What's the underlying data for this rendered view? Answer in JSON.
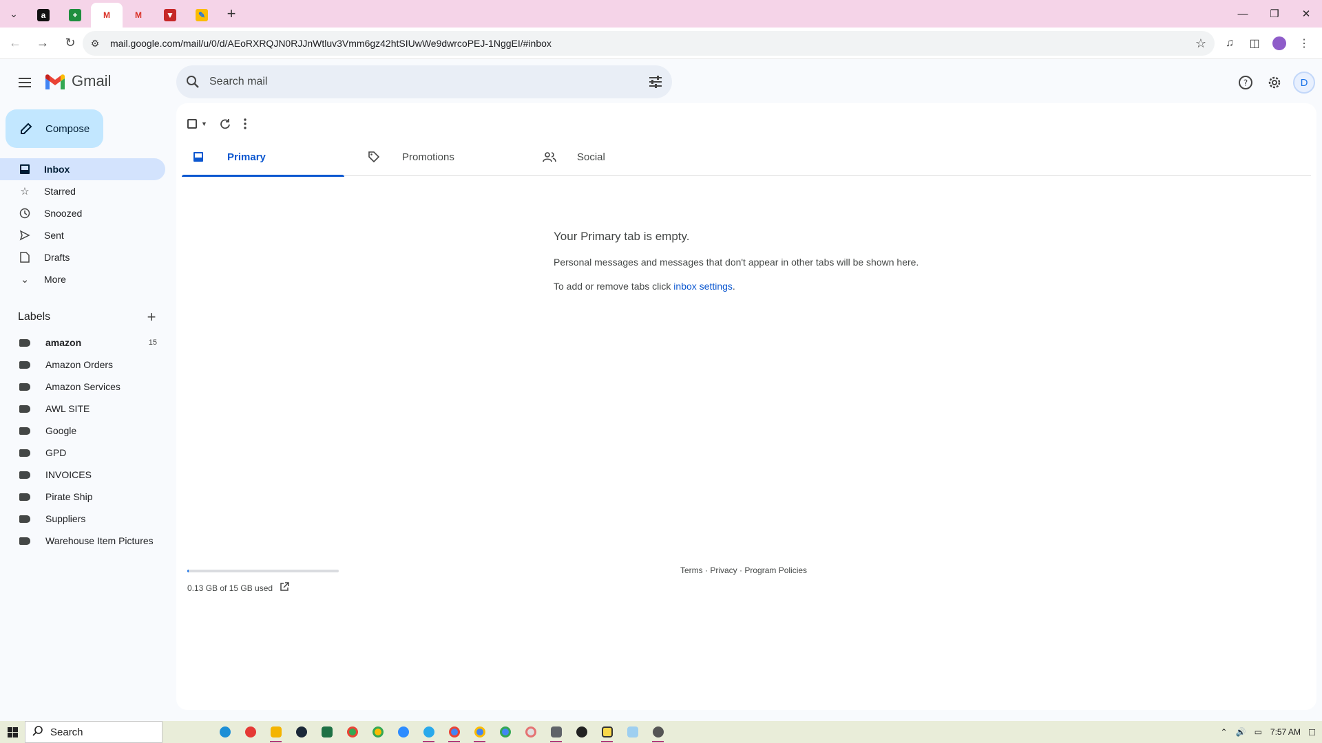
{
  "browser": {
    "url": "mail.google.com/mail/u/0/d/AEoRXRQJN0RJJnWtluv3Vmm6gz42htSIUwWe9dwrcoPEJ-1NggEI/#inbox",
    "tabs": [
      {
        "icon": "amazon-icon",
        "active": false
      },
      {
        "icon": "sheets-icon",
        "active": false
      },
      {
        "icon": "gmail-icon",
        "active": true
      },
      {
        "icon": "gmail-icon",
        "active": false
      },
      {
        "icon": "vivaldi-icon",
        "active": false
      },
      {
        "icon": "pencil-app-icon",
        "active": false
      }
    ]
  },
  "gmail": {
    "brand": "Gmail",
    "search_placeholder": "Search mail",
    "avatar_initial": "D",
    "compose_label": "Compose"
  },
  "nav": {
    "inbox": "Inbox",
    "starred": "Starred",
    "snoozed": "Snoozed",
    "sent": "Sent",
    "drafts": "Drafts",
    "more": "More"
  },
  "labels": {
    "title": "Labels",
    "items": [
      {
        "name": "amazon",
        "count": "15"
      },
      {
        "name": "Amazon Orders"
      },
      {
        "name": "Amazon Services"
      },
      {
        "name": "AWL SITE"
      },
      {
        "name": "Google"
      },
      {
        "name": "GPD"
      },
      {
        "name": "INVOICES"
      },
      {
        "name": "Pirate Ship"
      },
      {
        "name": "Suppliers"
      },
      {
        "name": "Warehouse Item Pictures"
      }
    ]
  },
  "inbox_tabs": {
    "primary": "Primary",
    "promotions": "Promotions",
    "social": "Social"
  },
  "empty_state": {
    "title": "Your Primary tab is empty.",
    "line1": "Personal messages and messages that don't appear in other tabs will be shown here.",
    "line2_prefix": "To add or remove tabs click ",
    "line2_link": "inbox settings",
    "line2_suffix": "."
  },
  "storage": {
    "text": "0.13 GB of 15 GB used",
    "fraction_used": 0.009
  },
  "footer": {
    "terms": "Terms",
    "sep1": " · ",
    "privacy": "Privacy",
    "sep2": " · ",
    "policies": "Program Policies"
  },
  "taskbar": {
    "search_label": "Search",
    "time": "7:57 AM"
  },
  "colors": {
    "accent": "#0b57d0",
    "compose_bg": "#c2e7ff",
    "active_nav_bg": "#d3e3fd",
    "tabstrip_bg": "#f5d4e8"
  }
}
